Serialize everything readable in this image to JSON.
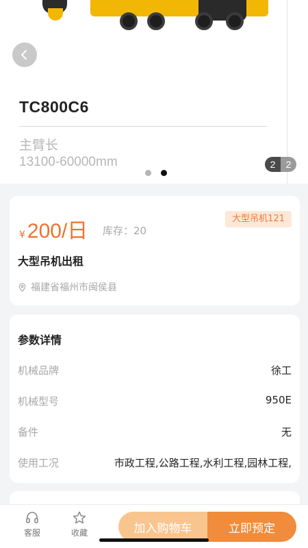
{
  "hero": {
    "model": "TC800C6",
    "spec_label": "主臂长",
    "spec_value": "13100-60000mm",
    "counter_current": "2",
    "counter_total": "2"
  },
  "product": {
    "currency": "¥",
    "price": "200/日",
    "stock": "库存：20",
    "tag": "大型吊机121",
    "title": "大型吊机出租",
    "location": "福建省福州市闽侯县"
  },
  "params": {
    "title": "参数详情",
    "rows": [
      {
        "key": "机械品牌",
        "value": "徐工"
      },
      {
        "key": "机械型号",
        "value": "950E"
      },
      {
        "key": "备件",
        "value": "无"
      },
      {
        "key": "使用工况",
        "value": "市政工程,公路工程,水利工程,园林工程,"
      }
    ]
  },
  "bottom_bar": {
    "service_label": "客服",
    "favorite_label": "收藏",
    "add_to_cart": "加入购物车",
    "book_now": "立即预定"
  },
  "colors": {
    "accent": "#f08c3b",
    "price": "#f0712d",
    "tag_bg": "#fde8d8"
  }
}
